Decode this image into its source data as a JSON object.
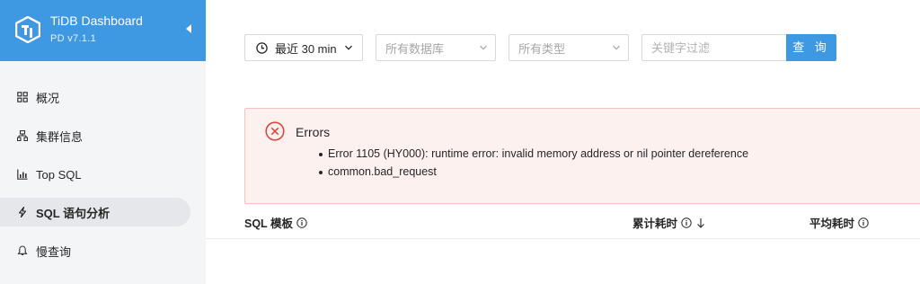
{
  "brand": {
    "title": "TiDB Dashboard",
    "version": "PD v7.1.1"
  },
  "sidebar": {
    "items": [
      {
        "label": "概况",
        "icon": "overview-icon"
      },
      {
        "label": "集群信息",
        "icon": "cluster-icon"
      },
      {
        "label": "Top SQL",
        "icon": "bar-chart-icon"
      },
      {
        "label": "SQL 语句分析",
        "icon": "thunder-icon",
        "active": true
      },
      {
        "label": "慢查询",
        "icon": "bell-icon"
      }
    ]
  },
  "filters": {
    "time_range": "最近 30 min",
    "database_placeholder": "所有数据库",
    "type_placeholder": "所有类型",
    "search_placeholder": "关键字过滤",
    "query_label": "查 询"
  },
  "error": {
    "title": "Errors",
    "messages": [
      "Error 1105 (HY000): runtime error: invalid memory address or nil pointer dereference",
      "common.bad_request"
    ]
  },
  "table": {
    "columns": [
      "SQL 模板",
      "累计耗时",
      "平均耗时"
    ]
  },
  "colors": {
    "accent": "#3f98e2",
    "error": "#e0463c",
    "error_bg": "#fdf1f0"
  }
}
